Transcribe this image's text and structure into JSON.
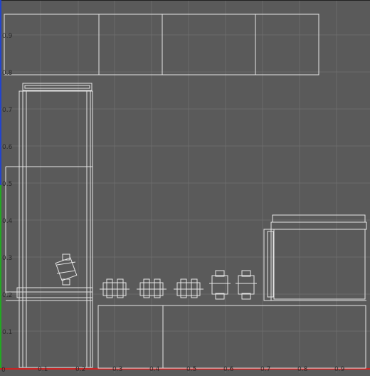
{
  "viewport": {
    "background": "#5a5a5a",
    "grid_color": "#6b6b6b",
    "wire_color": "#e6e6e6",
    "axis_x_color": "#cc2222",
    "axis_y_color": "#22aa22",
    "axis_z_color": "#2244cc",
    "label_color": "#2a2a2a"
  },
  "axis": {
    "x_ticks": [
      "0.1",
      "0.2",
      "0.3",
      "0.4",
      "0.5",
      "0.6",
      "0.7",
      "0.8",
      "0.9"
    ],
    "y_ticks": [
      "0.1",
      "0.2",
      "0.3",
      "0.4",
      "0.5",
      "0.6",
      "0.7",
      "0.8",
      "0.9"
    ],
    "origin": "0"
  }
}
